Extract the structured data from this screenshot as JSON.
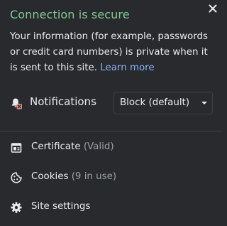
{
  "header": {
    "title": "Connection is secure",
    "close_icon": "close-icon"
  },
  "description": {
    "text": "Your information (for example, passwords or credit card numbers) is private when it is sent to this site. ",
    "link": "Learn more"
  },
  "permissions": [
    {
      "icon": "notifications-blocked-icon",
      "label": "Notifications",
      "value": "Block (default)"
    }
  ],
  "items": [
    {
      "icon": "certificate-icon",
      "label": "Certificate",
      "sub": "(Valid)"
    },
    {
      "icon": "cookie-icon",
      "label": "Cookies",
      "sub": "(9 in use)"
    },
    {
      "icon": "gear-icon",
      "label": "Site settings",
      "sub": ""
    }
  ],
  "colors": {
    "background": "#292a2d",
    "title_green": "#81c995",
    "link_blue": "#8ab4f8",
    "text": "#e8eaed",
    "muted": "#9aa0a6",
    "blocked_red": "#f28b82"
  }
}
